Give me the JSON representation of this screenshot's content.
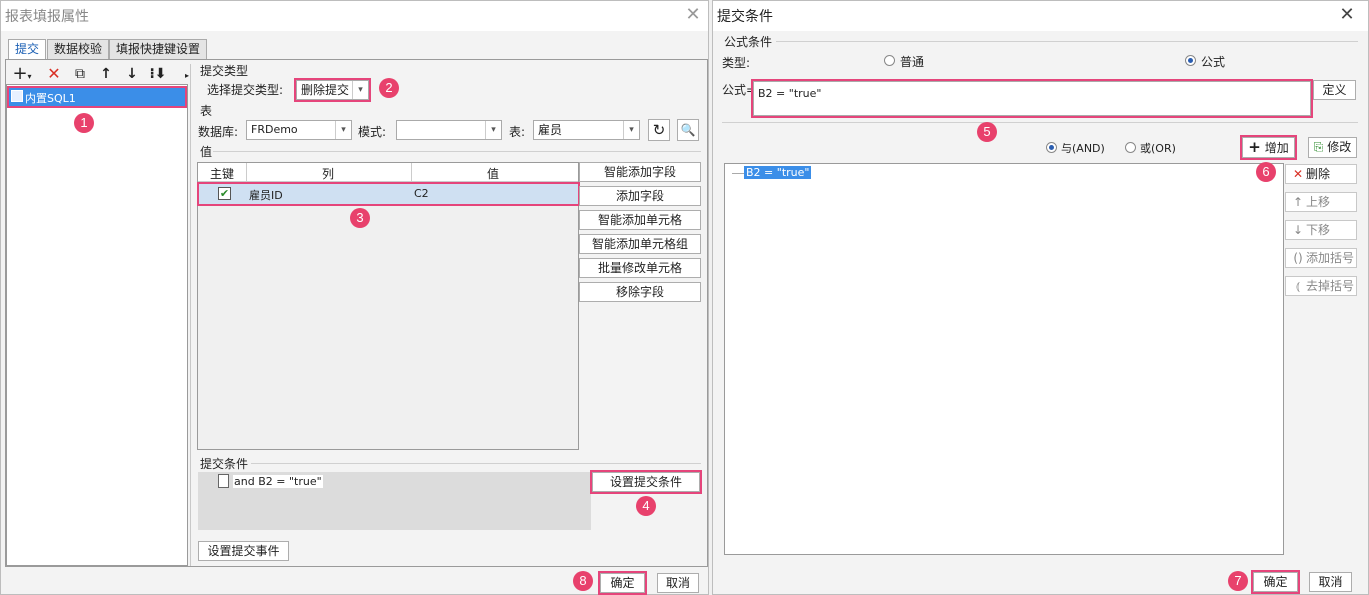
{
  "left_dialog": {
    "title": "报表填报属性",
    "tabs": [
      "提交",
      "数据校验",
      "填报快捷键设置"
    ],
    "tree_item": "内置SQL1",
    "submit_type": {
      "section": "提交类型",
      "label": "选择提交类型:",
      "value": "删除提交"
    },
    "table_section": {
      "title": "表",
      "db_label": "数据库:",
      "db_value": "FRDemo",
      "schema_label": "模式:",
      "schema_value": "",
      "table_label": "表:",
      "table_value": "雇员"
    },
    "value_section": {
      "title": "值",
      "headers": [
        "主键",
        "列",
        "值"
      ],
      "rows": [
        {
          "key": true,
          "column": "雇员ID",
          "value": "C2"
        }
      ],
      "buttons": [
        "智能添加字段",
        "添加字段",
        "智能添加单元格",
        "智能添加单元格组",
        "批量修改单元格",
        "移除字段"
      ]
    },
    "condition_section": {
      "title": "提交条件",
      "item": "and B2 = \"true\"",
      "set_button": "设置提交条件"
    },
    "event_button": "设置提交事件",
    "ok": "确定",
    "cancel": "取消"
  },
  "right_dialog": {
    "title": "提交条件",
    "formula_group": "公式条件",
    "type_label": "类型:",
    "type_options": [
      "普通",
      "公式"
    ],
    "type_selected": "公式",
    "formula_label": "公式=",
    "formula_value": "B2 = \"true\"",
    "define_button": "定义",
    "logic_options": [
      "与(AND)",
      "或(OR)"
    ],
    "logic_selected": "与(AND)",
    "add_button": "增加",
    "modify_button": "修改",
    "list_item": "B2 = \"true\"",
    "side_buttons": [
      "删除",
      "上移",
      "下移",
      "添加括号",
      "去掉括号"
    ],
    "ok": "确定",
    "cancel": "取消"
  },
  "badges": [
    "1",
    "2",
    "3",
    "4",
    "5",
    "6",
    "7",
    "8"
  ],
  "colors": {
    "highlight": "#e5457b",
    "badge": "#e8416c",
    "selection": "#3b8ee8"
  }
}
